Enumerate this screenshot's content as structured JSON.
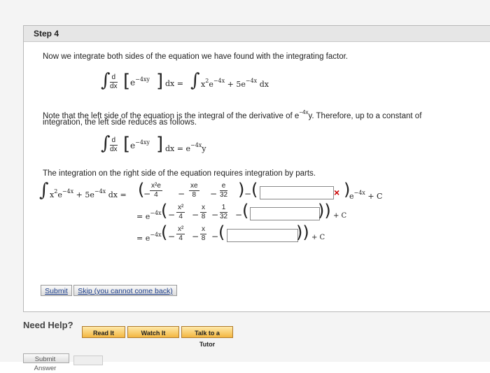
{
  "step": {
    "title": "Step 4"
  },
  "text": {
    "intro": "Now we integrate both sides of the equation we have found with the integrating factor.",
    "note_line1": "Note that the left side of the equation is the integral of the derivative of e",
    "note_exp": "−4x",
    "note_line1_end": "y. Therefore, up to a constant of",
    "note_line2": "integration, the left side reduces as follows.",
    "parts": "The integration on the right side of the equation requires integration by parts."
  },
  "math": {
    "d": "d",
    "dx": "dx",
    "e": "e",
    "exp_4xy": "−4xy",
    "exp_4x": "−4x",
    "y": "y",
    "dx_eq": "dx =",
    "x2e": "x",
    "two": "2",
    "plus5e": "+ 5e",
    "dxend": "dx",
    "rhs_e": "= e",
    "eq": "=",
    "minus": "−",
    "x2e4x": "x²e",
    "four": "4",
    "xe": "xe",
    "eight": "8",
    "thirtytwo": "32",
    "x2": "x²",
    "x": "x",
    "one": "1",
    "plusC": "+ C",
    "eq_e": "= e",
    "exp_4x_small": "−4x"
  },
  "inputs": {
    "box1": "",
    "box2": "",
    "box3": ""
  },
  "icons": {
    "wrong": "×"
  },
  "buttons": {
    "submit": "Submit",
    "skip": "Skip (you cannot come back)"
  },
  "help": {
    "title": "Need Help?",
    "read": "Read It",
    "watch": "Watch It",
    "tutor": "Talk to a Tutor"
  },
  "footer": {
    "submit_answer": "Submit Answer"
  }
}
